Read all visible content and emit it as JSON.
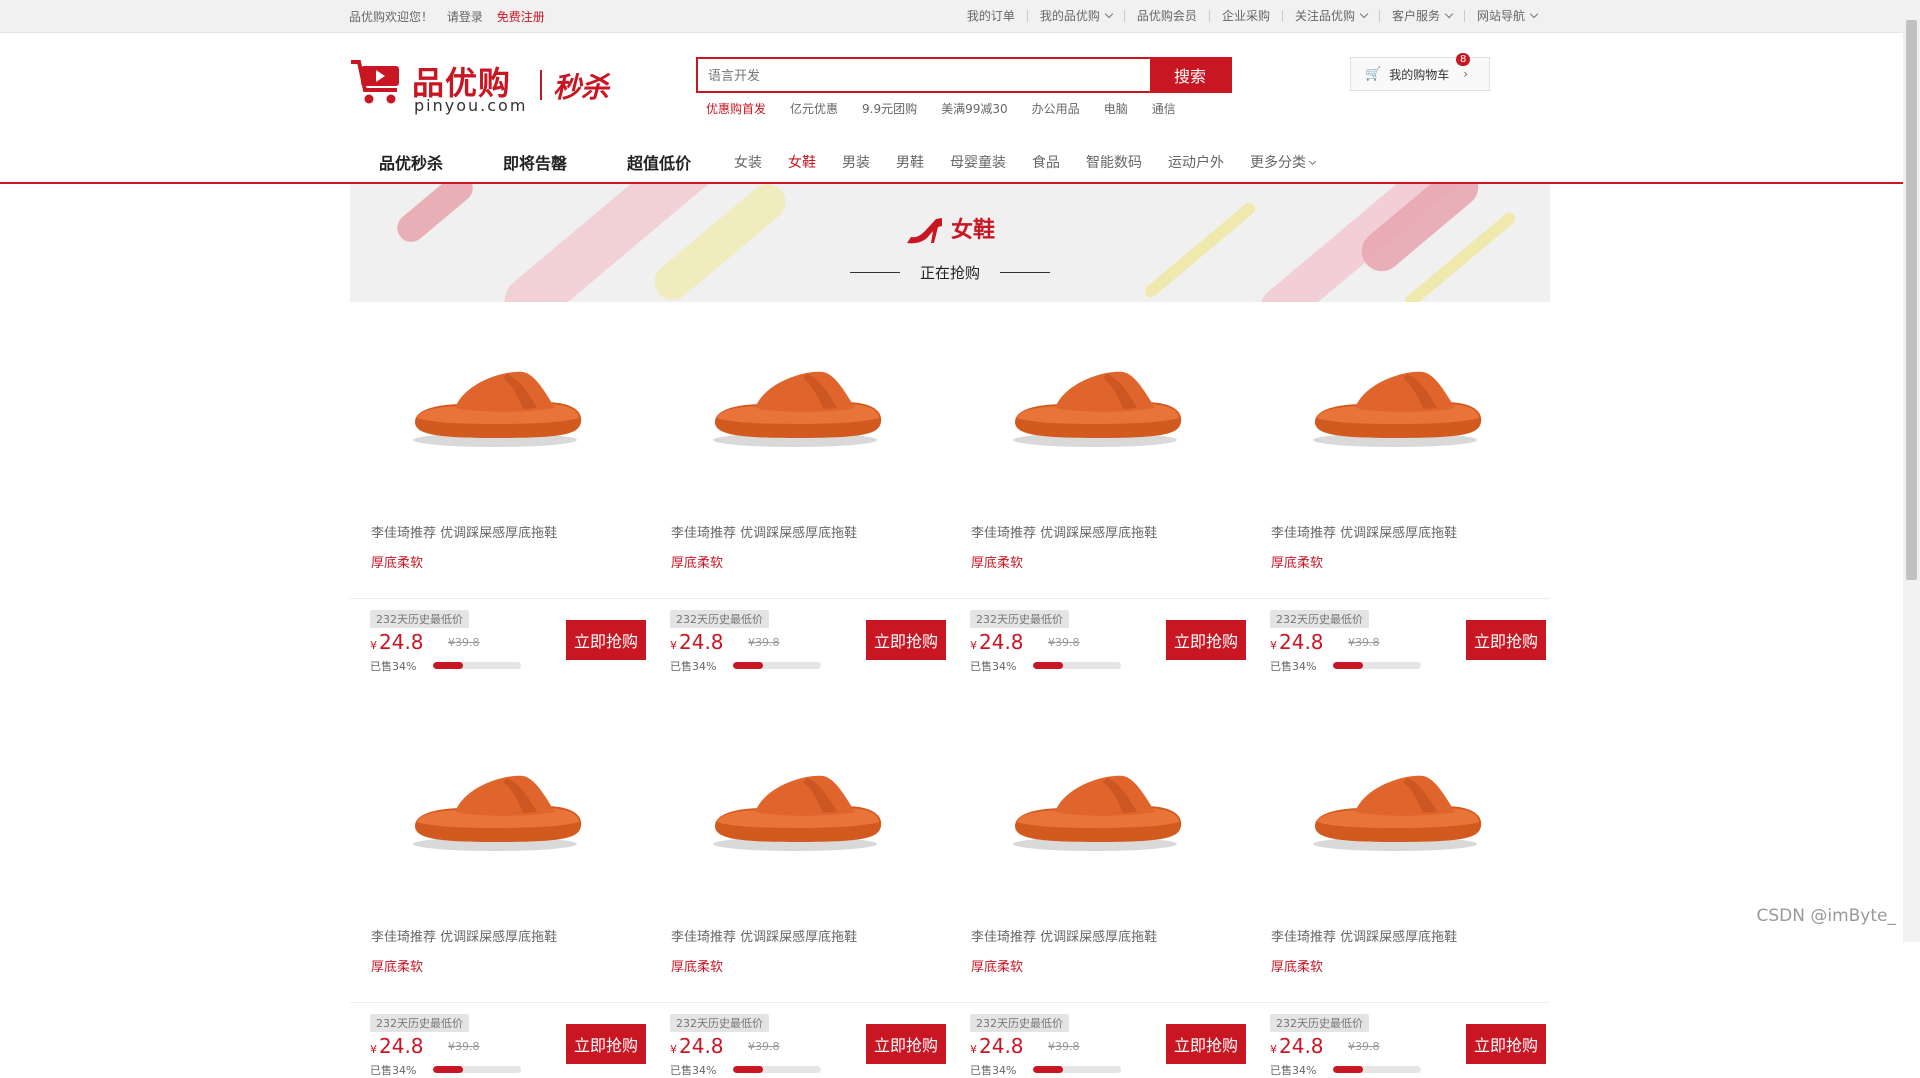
{
  "topbar": {
    "welcome": "品优购欢迎您！",
    "login": "请登录",
    "register": "免费注册",
    "links": [
      {
        "label": "我的订单",
        "dropdown": false
      },
      {
        "label": "我的品优购",
        "dropdown": true
      },
      {
        "label": "品优购会员",
        "dropdown": false
      },
      {
        "label": "企业采购",
        "dropdown": false
      },
      {
        "label": "关注品优购",
        "dropdown": true
      },
      {
        "label": "客户服务",
        "dropdown": true
      },
      {
        "label": "网站导航",
        "dropdown": true
      }
    ]
  },
  "logo": {
    "name": "品优购",
    "domain": "pinyou.com",
    "seckill": "秒杀"
  },
  "search": {
    "placeholder": "语言开发",
    "button": "搜索",
    "hotwords": [
      "优惠购首发",
      "亿元优惠",
      "9.9元团购",
      "美满99减30",
      "办公用品",
      "电脑",
      "通信"
    ]
  },
  "cart": {
    "label": "我的购物车",
    "count": "8"
  },
  "nav": {
    "main": [
      "品优秒杀",
      "即将告罄",
      "超值低价"
    ],
    "categories": [
      "女装",
      "女鞋",
      "男装",
      "男鞋",
      "母婴童装",
      "食品",
      "智能数码",
      "运动户外",
      "更多分类"
    ],
    "active_category": "女鞋"
  },
  "banner": {
    "title": "女鞋",
    "subtitle": "正在抢购"
  },
  "products": [
    {
      "name": "李佳琦推荐 优调踩屎感厚底拖鞋",
      "tag": "厚底柔软",
      "badge": "232天历史最低价",
      "currency": "¥",
      "price": "24.8",
      "original": "¥39.8",
      "sold": "已售34%",
      "sold_fraction": 0.34,
      "buy": "立即抢购"
    },
    {
      "name": "李佳琦推荐 优调踩屎感厚底拖鞋",
      "tag": "厚底柔软",
      "badge": "232天历史最低价",
      "currency": "¥",
      "price": "24.8",
      "original": "¥39.8",
      "sold": "已售34%",
      "sold_fraction": 0.34,
      "buy": "立即抢购"
    },
    {
      "name": "李佳琦推荐 优调踩屎感厚底拖鞋",
      "tag": "厚底柔软",
      "badge": "232天历史最低价",
      "currency": "¥",
      "price": "24.8",
      "original": "¥39.8",
      "sold": "已售34%",
      "sold_fraction": 0.34,
      "buy": "立即抢购"
    },
    {
      "name": "李佳琦推荐 优调踩屎感厚底拖鞋",
      "tag": "厚底柔软",
      "badge": "232天历史最低价",
      "currency": "¥",
      "price": "24.8",
      "original": "¥39.8",
      "sold": "已售34%",
      "sold_fraction": 0.34,
      "buy": "立即抢购"
    },
    {
      "name": "李佳琦推荐 优调踩屎感厚底拖鞋",
      "tag": "厚底柔软",
      "badge": "232天历史最低价",
      "currency": "¥",
      "price": "24.8",
      "original": "¥39.8",
      "sold": "已售34%",
      "sold_fraction": 0.34,
      "buy": "立即抢购"
    },
    {
      "name": "李佳琦推荐 优调踩屎感厚底拖鞋",
      "tag": "厚底柔软",
      "badge": "232天历史最低价",
      "currency": "¥",
      "price": "24.8",
      "original": "¥39.8",
      "sold": "已售34%",
      "sold_fraction": 0.34,
      "buy": "立即抢购"
    },
    {
      "name": "李佳琦推荐 优调踩屎感厚底拖鞋",
      "tag": "厚底柔软",
      "badge": "232天历史最低价",
      "currency": "¥",
      "price": "24.8",
      "original": "¥39.8",
      "sold": "已售34%",
      "sold_fraction": 0.34,
      "buy": "立即抢购"
    },
    {
      "name": "李佳琦推荐 优调踩屎感厚底拖鞋",
      "tag": "厚底柔软",
      "badge": "232天历史最低价",
      "currency": "¥",
      "price": "24.8",
      "original": "¥39.8",
      "sold": "已售34%",
      "sold_fraction": 0.34,
      "buy": "立即抢购"
    }
  ],
  "watermark": "CSDN @imByte_",
  "colors": {
    "brand": "#c81623",
    "product": "#e0632a"
  }
}
